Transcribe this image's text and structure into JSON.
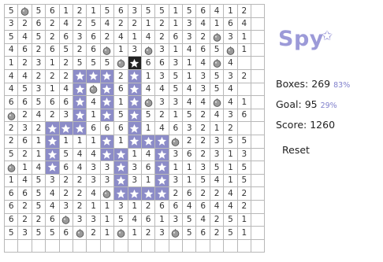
{
  "board": {
    "rows": [
      [
        "5",
        "B",
        "5",
        "6",
        "1",
        "2",
        "1",
        "5",
        "6",
        "3",
        "5",
        "5",
        "1",
        "5",
        "6",
        "4",
        "1",
        "2",
        ""
      ],
      [
        "3",
        "2",
        "6",
        "2",
        "4",
        "2",
        "5",
        "4",
        "2",
        "2",
        "1",
        "2",
        "1",
        "3",
        "4",
        "1",
        "6",
        "4",
        ""
      ],
      [
        "5",
        "4",
        "5",
        "2",
        "6",
        "3",
        "6",
        "2",
        "4",
        "1",
        "4",
        "2",
        "6",
        "3",
        "2",
        "B",
        "3",
        "1",
        ""
      ],
      [
        "4",
        "6",
        "2",
        "6",
        "5",
        "2",
        "6",
        "B",
        "1",
        "3",
        "B",
        "3",
        "1",
        "4",
        "6",
        "5",
        "B",
        "1",
        ""
      ],
      [
        "1",
        "2",
        "3",
        "1",
        "2",
        "5",
        "5",
        "5",
        "B",
        "SEL",
        "6",
        "6",
        "3",
        "1",
        "4",
        "B",
        "4",
        ""
      ],
      [
        "4",
        "4",
        "2",
        "2",
        "2",
        "S",
        "S",
        "S",
        "2",
        "S",
        "1",
        "3",
        "5",
        "1",
        "3",
        "5",
        "3",
        "2",
        ""
      ],
      [
        "4",
        "5",
        "3",
        "1",
        "4",
        "S",
        "B",
        "S",
        "6",
        "S",
        "4",
        "4",
        "5",
        "4",
        "3",
        "5",
        "4",
        ""
      ],
      [
        "6",
        "6",
        "5",
        "6",
        "6",
        "S",
        "4",
        "S",
        "1",
        "S",
        "B",
        "3",
        "3",
        "4",
        "4",
        "B",
        "4",
        "1",
        ""
      ],
      [
        "B",
        "2",
        "4",
        "2",
        "3",
        "S",
        "1",
        "S",
        "5",
        "S",
        "5",
        "2",
        "1",
        "5",
        "2",
        "4",
        "3",
        "6",
        ""
      ],
      [
        "2",
        "3",
        "2",
        "S",
        "S",
        "S",
        "6",
        "6",
        "6",
        "S",
        "1",
        "4",
        "6",
        "3",
        "2",
        "1",
        "2",
        ""
      ],
      [
        "2",
        "6",
        "1",
        "S",
        "1",
        "1",
        "1",
        "S",
        "1",
        "S",
        "S",
        "S",
        "B",
        "2",
        "2",
        "3",
        "5",
        "5",
        ""
      ],
      [
        "5",
        "2",
        "1",
        "S",
        "5",
        "4",
        "4",
        "S",
        "S",
        "1",
        "4",
        "S",
        "3",
        "6",
        "2",
        "3",
        "1",
        "3",
        ""
      ],
      [
        "B",
        "1",
        "4",
        "S",
        "6",
        "4",
        "3",
        "3",
        "S",
        "3",
        "6",
        "S",
        "1",
        "1",
        "3",
        "5",
        "1",
        "5",
        ""
      ],
      [
        "1",
        "4",
        "5",
        "3",
        "2",
        "2",
        "3",
        "3",
        "S",
        "3",
        "1",
        "S",
        "3",
        "1",
        "5",
        "4",
        "1",
        "5",
        ""
      ],
      [
        "6",
        "6",
        "5",
        "4",
        "2",
        "2",
        "4",
        "B",
        "S",
        "S",
        "S",
        "S",
        "2",
        "6",
        "2",
        "2",
        "4",
        "2",
        ""
      ],
      [
        "6",
        "2",
        "5",
        "4",
        "3",
        "2",
        "1",
        "1",
        "3",
        "1",
        "2",
        "6",
        "6",
        "4",
        "6",
        "4",
        "4",
        "2",
        ""
      ],
      [
        "6",
        "2",
        "2",
        "6",
        "B",
        "3",
        "3",
        "1",
        "5",
        "4",
        "6",
        "1",
        "3",
        "5",
        "4",
        "2",
        "5",
        "1",
        ""
      ],
      [
        "5",
        "3",
        "5",
        "5",
        "6",
        "B",
        "2",
        "1",
        "B",
        "1",
        "2",
        "3",
        "B",
        "5",
        "6",
        "2",
        "5",
        "1",
        ""
      ],
      [
        "",
        "",
        "",
        "",
        "",
        "",
        "",
        "",
        "",
        "",
        "",
        "",
        "",
        "",
        "",
        "",
        "",
        "",
        ""
      ]
    ]
  },
  "logo_text": "Spy",
  "icons": {
    "bomb": "bomb-icon",
    "star": "star-icon",
    "logo_star": "star-icon"
  },
  "colors": {
    "star_bg": "#8c8cc8",
    "selected_bg": "#222222",
    "accent": "#9c9ad8"
  },
  "stats": {
    "boxes_label": "Boxes:",
    "boxes_value": "269",
    "boxes_pct": "83%",
    "goal_label": "Goal:",
    "goal_value": "95",
    "goal_pct": "29%",
    "score_label": "Score:",
    "score_value": "1260"
  },
  "reset_label": "Reset"
}
